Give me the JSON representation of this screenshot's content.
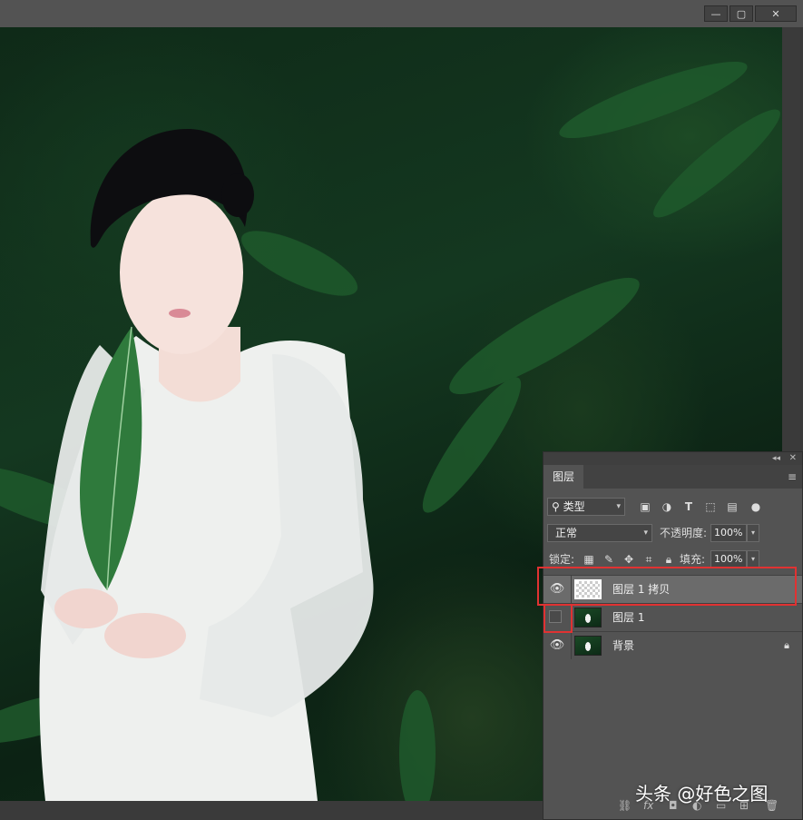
{
  "window": {
    "minimize_symbol": "—",
    "maximize_symbol": "▢",
    "close_symbol": "✕"
  },
  "panel": {
    "collapse_symbol": "◂◂",
    "close_symbol": "✕",
    "tab_label": "图层",
    "menu_symbol": "≡",
    "filter": {
      "search_symbol": "⚲",
      "value": "类型",
      "icons": [
        "image-filter-icon",
        "adjustment-filter-icon",
        "type-filter-icon",
        "shape-filter-icon",
        "smart-object-filter-icon",
        "toggle-filter-icon"
      ]
    },
    "blend_mode": "正常",
    "opacity_label": "不透明度:",
    "opacity_value": "100%",
    "lock_label": "锁定:",
    "fill_label": "填充:",
    "fill_value": "100%",
    "layers": [
      {
        "name": "图层 1 拷贝",
        "visible": true,
        "selected": true,
        "thumbnail": "transparent",
        "locked": false
      },
      {
        "name": "图层 1",
        "visible": false,
        "selected": false,
        "thumbnail": "photo",
        "locked": false
      },
      {
        "name": "背景",
        "visible": true,
        "selected": false,
        "thumbnail": "photo",
        "locked": true
      }
    ],
    "footer_icons": [
      "link-icon",
      "fx-icon",
      "mask-icon",
      "adjustment-icon",
      "group-icon",
      "new-layer-icon",
      "delete-icon"
    ]
  },
  "watermark": "头条 @好色之图",
  "highlight_color": "#e03232"
}
